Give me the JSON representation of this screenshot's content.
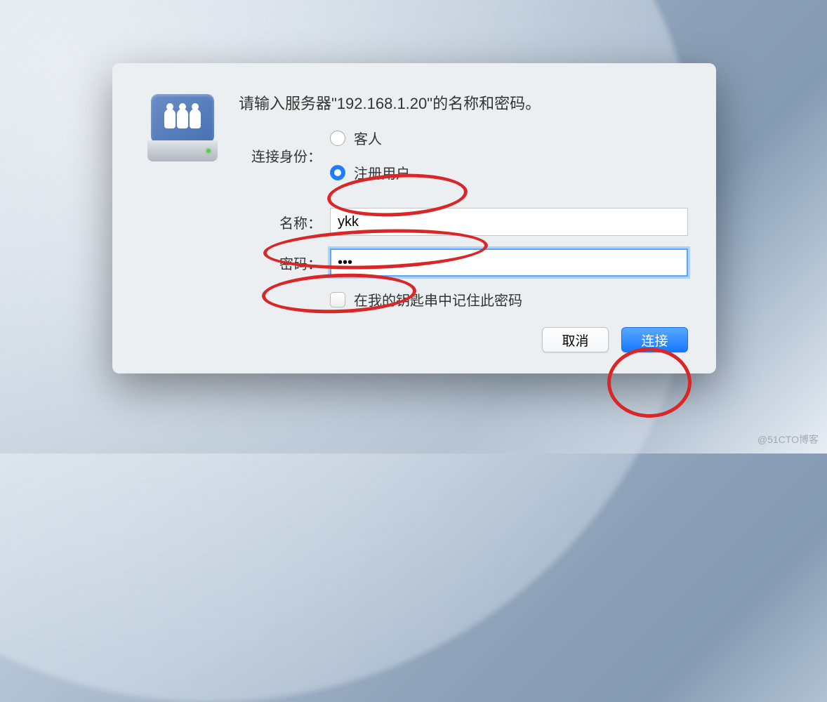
{
  "prompt": "请输入服务器\"192.168.1.20\"的名称和密码。",
  "identity": {
    "label": "连接身份：",
    "guest": "客人",
    "registered": "注册用户"
  },
  "fields": {
    "name_label": "名称：",
    "name_value": "ykk",
    "password_label": "密码：",
    "password_value": "•••"
  },
  "remember": {
    "label": "在我的钥匙串中记住此密码"
  },
  "buttons": {
    "cancel": "取消",
    "connect": "连接"
  },
  "watermark": "@51CTO博客"
}
